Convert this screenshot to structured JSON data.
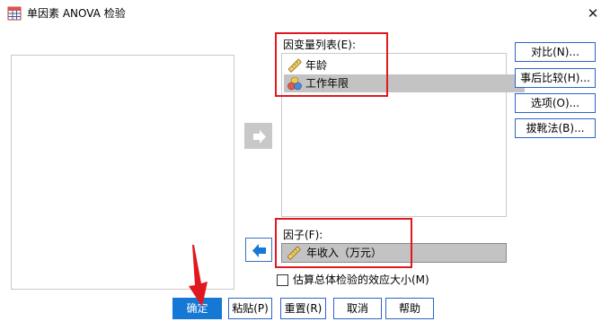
{
  "window": {
    "title": "单因素 ANOVA 检验",
    "close_label": "✕"
  },
  "dependent_list": {
    "label": "因变量列表(E):",
    "items": [
      {
        "label": "年龄",
        "icon": "ruler-icon",
        "selected": false
      },
      {
        "label": "工作年限",
        "icon": "nominal-circles-icon",
        "selected": true
      }
    ]
  },
  "factor": {
    "label": "因子(F):",
    "value": "年收入（万元）",
    "icon": "ruler-icon"
  },
  "side_buttons": [
    "对比(N)...",
    "事后比较(H)...",
    "选项(O)...",
    "拔靴法(B)..."
  ],
  "checkbox": {
    "label": "估算总体检验的效应大小(M)",
    "checked": false
  },
  "bottom_buttons": [
    "确定",
    "粘贴(P)",
    "重置(R)",
    "取消",
    "帮助"
  ],
  "colors": {
    "accent": "#1478d4",
    "highlight_box": "#e0191e",
    "selection": "#c3c3c3"
  }
}
